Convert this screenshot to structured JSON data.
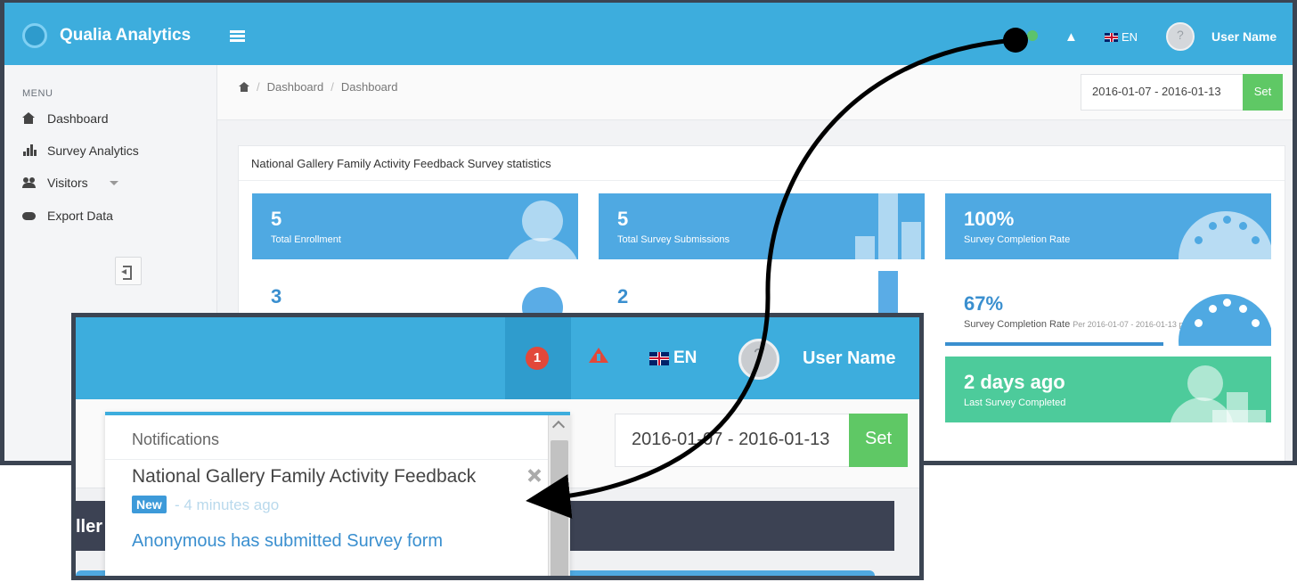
{
  "app": {
    "title": "Qualia Analytics"
  },
  "topbar": {
    "language": "EN",
    "user_name": "User Name"
  },
  "sidebar": {
    "menu_title": "MENU",
    "items": [
      {
        "label": "Dashboard",
        "icon": "home-icon"
      },
      {
        "label": "Survey Analytics",
        "icon": "bar-chart-icon"
      },
      {
        "label": "Visitors",
        "icon": "users-icon"
      },
      {
        "label": "Export Data",
        "icon": "cloud-download-icon"
      }
    ]
  },
  "breadcrumb": [
    "Dashboard",
    "Dashboard"
  ],
  "date_range": {
    "value": "2016-01-07 - 2016-01-13",
    "set_label": "Set"
  },
  "panel": {
    "title": "National Gallery Family Activity Feedback Survey statistics"
  },
  "tiles": [
    {
      "value": "5",
      "label": "Total Enrollment"
    },
    {
      "value": "5",
      "label": "Total Survey Submissions"
    },
    {
      "value": "100%",
      "label": "Survey Completion Rate"
    },
    {
      "value": "3",
      "label": ""
    },
    {
      "value": "2",
      "label": ""
    },
    {
      "value": "67%",
      "label": "Survey Completion Rate",
      "period": "Per 2016-01-07 - 2016-01-13 period",
      "progress": 0.67
    },
    {
      "value": "2 days ago",
      "label": "Last Survey Completed"
    }
  ],
  "zoom": {
    "notification_count": "1",
    "language": "EN",
    "user_name": "User Name",
    "date_range": "2016-01-07 - 2016-01-13",
    "set_label": "Set",
    "dark_bar_fragment": "ller",
    "notifications": {
      "title": "Notifications",
      "item": {
        "title": "National Gallery Family Activity Feedback",
        "badge": "New",
        "time": "- 4 minutes ago",
        "message": "Anonymous has submitted Survey form"
      }
    }
  },
  "colors": {
    "topbar": "#3daddd",
    "tile_blue": "#4fa9e2",
    "tile_green": "#4dcb9b",
    "set_button": "#5fc865",
    "badge_red": "#e2483a",
    "frame_border": "#3b4452"
  }
}
